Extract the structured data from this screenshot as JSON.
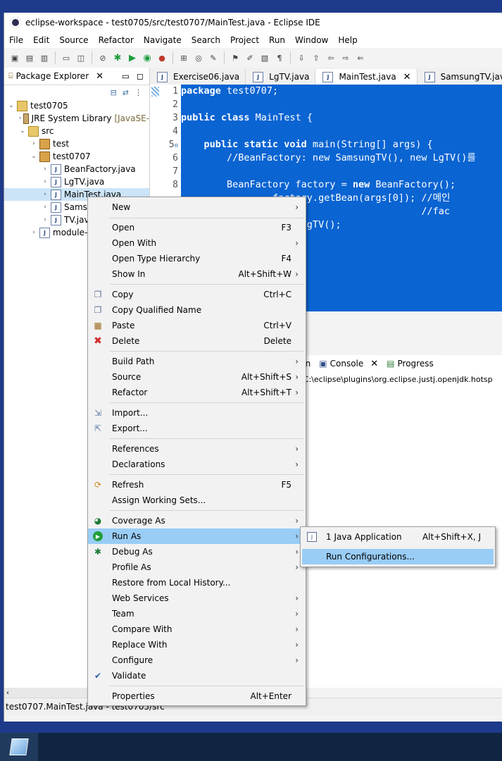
{
  "window": {
    "title": "eclipse-workspace - test0705/src/test0707/MainTest.java - Eclipse IDE"
  },
  "menubar": [
    "File",
    "Edit",
    "Source",
    "Refactor",
    "Navigate",
    "Search",
    "Project",
    "Run",
    "Window",
    "Help"
  ],
  "package_explorer": {
    "tab_label": "Package Explorer",
    "tree": {
      "project": "test0705",
      "jre": "JRE System Library",
      "jre_suffix": "[JavaSE-",
      "src": "src",
      "pkg_test": "test",
      "pkg_test0707": "test0707",
      "file_beanfactory": "BeanFactory.java",
      "file_lgtv": "LgTV.java",
      "file_maintest": "MainTest.java",
      "file_samsung": "Sams",
      "file_tv": "TV.jav",
      "module": "module-"
    }
  },
  "editor": {
    "tabs": [
      "Exercise06.java",
      "LgTV.java",
      "MainTest.java",
      "SamsungTV.java"
    ],
    "line_numbers": [
      "1",
      "2",
      "3",
      "4",
      "5",
      "6",
      "7",
      "8"
    ],
    "fold_marker_line": "5",
    "code": {
      "l1_kw": "package",
      "l1_rest": " test0707;",
      "l3_kw": "public class",
      "l3_rest": " MainTest {",
      "l5_kw": "    public static void",
      "l5_rest": " main(String[] args) {",
      "l6": "        //BeanFactory: new SamsungTV(), new LgTV()를",
      "l8_a": "        BeanFactory factory = ",
      "l8_kw": "new",
      "l8_b": " BeanFactory();",
      "l9": "                factory.getBean(args[0]); //메인",
      "l10": "                                          //fac",
      "l11": "              w SamsungTV();",
      "l12": "                ;",
      "l13": "                ;",
      "l14": "                ();",
      "l15": "                );"
    }
  },
  "bottom_panel": {
    "partial_tab": "ion",
    "console_tab": "Console",
    "progress_tab": "Progress",
    "console_text": "] C:\\eclipse\\plugins\\org.eclipse.justj.openjdk.hotsp"
  },
  "status_bar": {
    "text": "test0707.MainTest.java - test0705/src"
  },
  "context_menu": {
    "new": "New",
    "open": "Open",
    "open_sc": "F3",
    "open_with": "Open With",
    "open_type_hierarchy": "Open Type Hierarchy",
    "open_type_hierarchy_sc": "F4",
    "show_in": "Show In",
    "show_in_sc": "Alt+Shift+W",
    "copy": "Copy",
    "copy_sc": "Ctrl+C",
    "copy_qualified": "Copy Qualified Name",
    "paste": "Paste",
    "paste_sc": "Ctrl+V",
    "delete": "Delete",
    "delete_sc": "Delete",
    "build_path": "Build Path",
    "source": "Source",
    "source_sc": "Alt+Shift+S",
    "refactor": "Refactor",
    "refactor_sc": "Alt+Shift+T",
    "import": "Import...",
    "export": "Export...",
    "references": "References",
    "declarations": "Declarations",
    "refresh": "Refresh",
    "refresh_sc": "F5",
    "assign_working_sets": "Assign Working Sets...",
    "coverage_as": "Coverage As",
    "run_as": "Run As",
    "debug_as": "Debug As",
    "profile_as": "Profile As",
    "restore_history": "Restore from Local History...",
    "web_services": "Web Services",
    "team": "Team",
    "compare_with": "Compare With",
    "replace_with": "Replace With",
    "configure": "Configure",
    "validate": "Validate",
    "properties": "Properties",
    "properties_sc": "Alt+Enter"
  },
  "run_as_submenu": {
    "java_app": "1 Java Application",
    "java_app_sc": "Alt+Shift+X, J",
    "run_configs": "Run Configurations..."
  }
}
